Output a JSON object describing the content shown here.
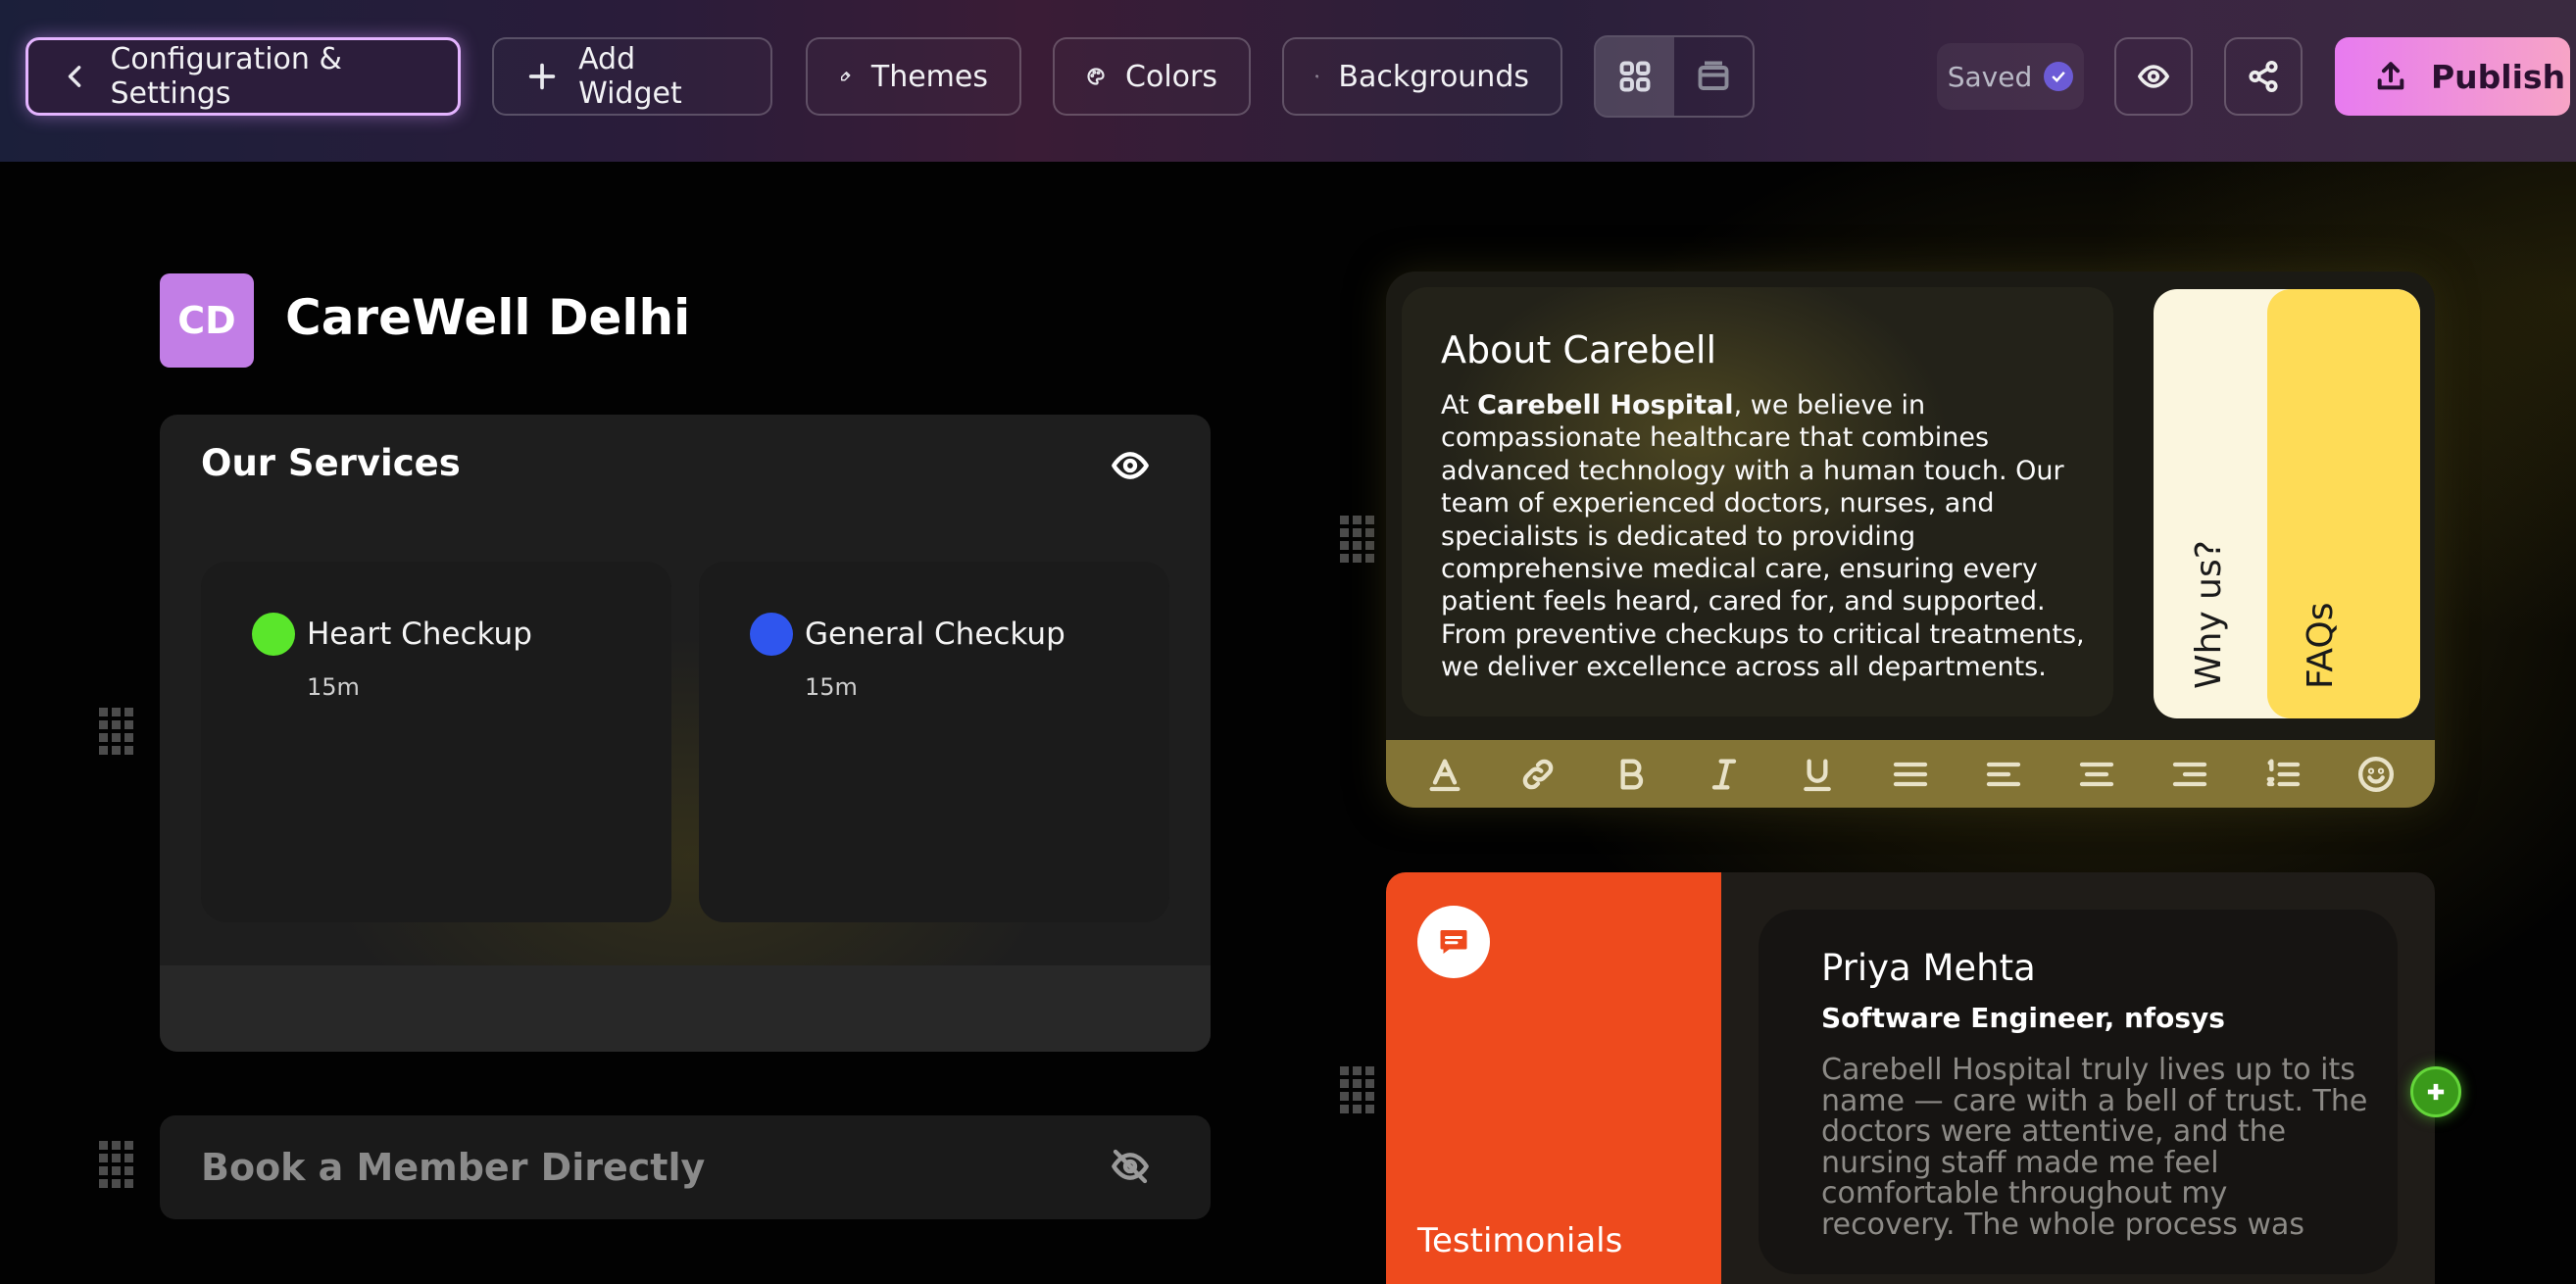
{
  "toolbar": {
    "config_label": "Configuration & Settings",
    "add_widget_label": "Add Widget",
    "themes_label": "Themes",
    "colors_label": "Colors",
    "backgrounds_label": "Backgrounds",
    "layout_options": [
      "grid-layout-icon",
      "stack-layout-icon"
    ],
    "layout_selected": "grid-layout-icon",
    "saved_label": "Saved",
    "publish_label": "Publish",
    "accent": "#e77bf0"
  },
  "profile": {
    "initials": "CD",
    "name": "CareWell Delhi",
    "avatar_color": "#c27ee6"
  },
  "services": {
    "title": "Our Services",
    "items": [
      {
        "name": "Heart Checkup",
        "duration": "15m",
        "color": "#5ae62b"
      },
      {
        "name": "General Checkup",
        "duration": "15m",
        "color": "#2f55ee"
      }
    ]
  },
  "book": {
    "label": "Book a Member Directly"
  },
  "about": {
    "title": "About Carebell",
    "body_prefix": "At ",
    "body_bold": "Carebell Hospital",
    "body_rest": ", we believe in compassionate healthcare that combines advanced technology with a human touch. Our team of experienced doctors, nurses, and specialists is dedicated to providing comprehensive medical care, ensuring every patient feels heard, cared for, and supported. From preventive checkups to critical treatments, we deliver excellence across all departments.",
    "tabs": [
      "Why us?",
      "FAQs"
    ],
    "tab_colors": [
      "#fbf6df",
      "#fedc57"
    ],
    "editor_tools": [
      "text-color-icon",
      "link-icon",
      "bold-icon",
      "italic-icon",
      "underline-icon",
      "justify-icon",
      "align-left-icon",
      "align-center-icon",
      "align-right-icon",
      "numbered-list-icon",
      "emoji-icon"
    ]
  },
  "testimonials": {
    "label": "Testimonials",
    "name": "Priya Mehta",
    "role": "Software Engineer, nfosys",
    "text": "Carebell Hospital truly lives up to its name — care with a bell of trust. The doctors were attentive, and the nursing staff made me feel comfortable throughout my recovery. The whole process was",
    "accent": "#ee4a1d"
  }
}
